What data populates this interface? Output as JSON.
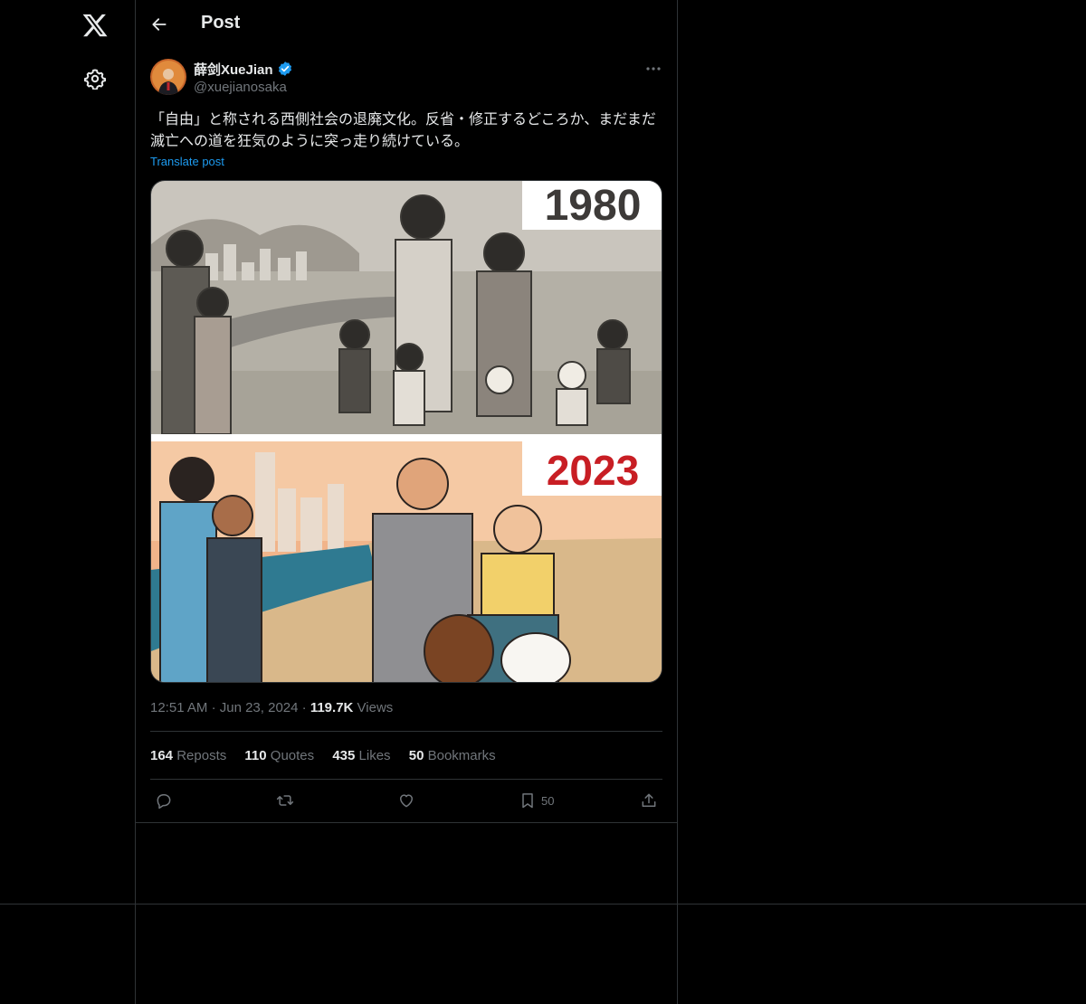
{
  "header": {
    "title": "Post"
  },
  "post": {
    "author_name": "薛剑XueJian",
    "handle": "@xuejianosaka",
    "text": "「自由」と称される西側社会の退廃文化。反省・修正するどころか、まだまだ滅亡への道を狂気のように突っ走り続けている。",
    "translate_label": "Translate post",
    "media": {
      "label_top": "1980",
      "label_bottom": "2023"
    },
    "time": "12:51 AM",
    "date": "Jun 23, 2024",
    "views_count": "119.7K",
    "views_label": "Views"
  },
  "stats": [
    {
      "count": "164",
      "label": "Reposts"
    },
    {
      "count": "110",
      "label": "Quotes"
    },
    {
      "count": "435",
      "label": "Likes"
    },
    {
      "count": "50",
      "label": "Bookmarks"
    }
  ],
  "actions": {
    "bookmark_count": "50"
  },
  "colors": {
    "background": "#000000",
    "accent": "#1d9bf0",
    "border": "#2f3336",
    "muted": "#71767b",
    "text": "#e7e9ea"
  },
  "icons": [
    "x-logo-icon",
    "gear-icon",
    "back-arrow-icon",
    "verified-badge-icon",
    "more-icon",
    "reply-icon",
    "repost-icon",
    "like-icon",
    "bookmark-icon",
    "share-icon"
  ]
}
